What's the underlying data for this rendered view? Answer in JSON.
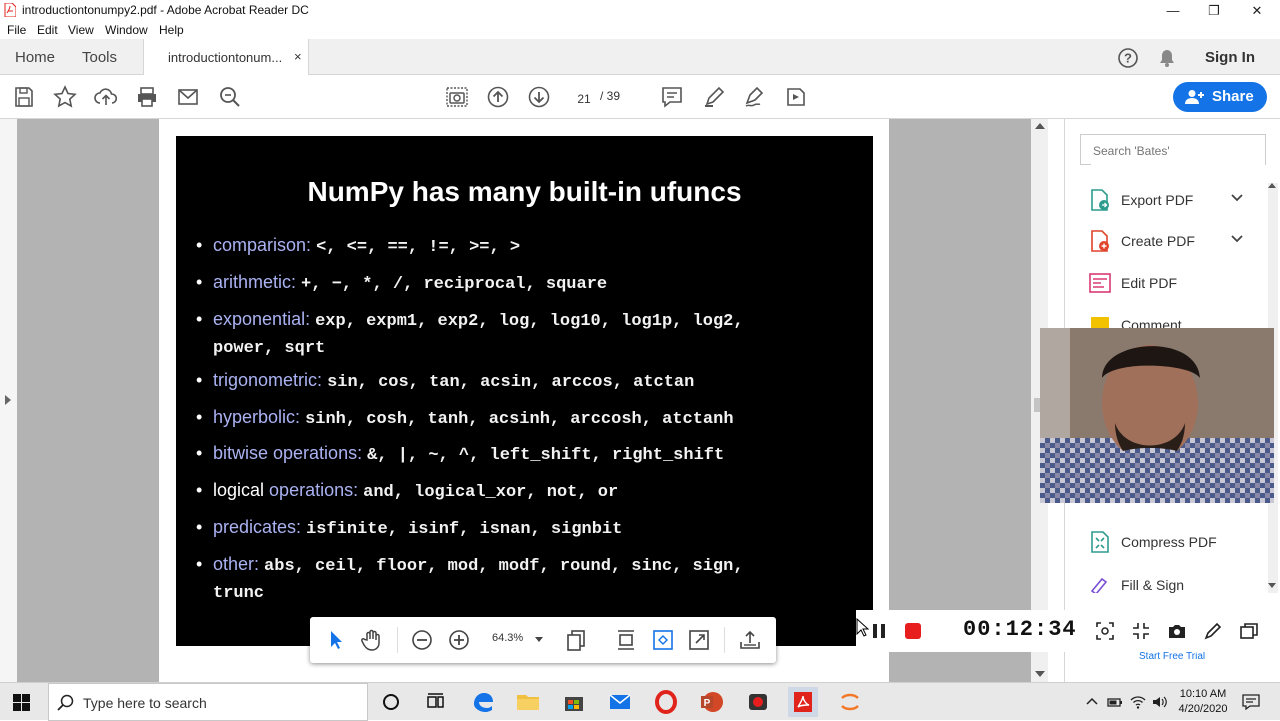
{
  "window": {
    "title": "introductiontonumpy2.pdf - Adobe Acrobat Reader DC",
    "controls": [
      "—",
      "❐",
      "✕"
    ]
  },
  "menu": [
    "File",
    "Edit",
    "View",
    "Window",
    "Help"
  ],
  "tabs": {
    "home": "Home",
    "tools": "Tools",
    "doc": "introductiontonum...",
    "close": "×"
  },
  "header_right": {
    "help": "?",
    "signin": "Sign In"
  },
  "toolbar": {
    "page_current": "21",
    "page_sep": "/ 39",
    "share_label": "Share"
  },
  "slide": {
    "title": "NumPy has many built-in ufuncs",
    "bullets": [
      {
        "label": "comparison:",
        "items": "<, <=, ==, !=, >=, >"
      },
      {
        "label": "arithmetic:",
        "items": "+, −, *, /, reciprocal, square"
      },
      {
        "label": "exponential:",
        "items": "exp, expm1, exp2, log, log10, log1p, log2,",
        "items2": "power, sqrt"
      },
      {
        "label": "trigonometric:",
        "items": "sin, cos, tan, acsin, arccos, atctan"
      },
      {
        "label": "hyperbolic:",
        "items": "sinh, cosh, tanh, acsinh, arccosh, atctanh"
      },
      {
        "label": "bitwise operations:",
        "items": "&, |, ~, ^, left_shift, right_shift"
      },
      {
        "label_white": "logical",
        "label": "operations:",
        "items": "and, logical_xor, not, or"
      },
      {
        "label": "predicates:",
        "items": "isfinite, isinf, isnan, signbit"
      },
      {
        "label": "other:",
        "items": "abs, ceil, floor, mod, modf, round, sinc, sign,",
        "items2": "trunc"
      }
    ]
  },
  "rightpane": {
    "search_placeholder": "Search 'Bates'",
    "tools": [
      {
        "name": "Export PDF",
        "color": "#2d9c8f"
      },
      {
        "name": "Create PDF",
        "color": "#e0442b"
      },
      {
        "name": "Edit PDF",
        "color": "#d83b74"
      },
      {
        "name": "Comment",
        "color": "#f2c200"
      },
      {
        "name": "Compress PDF",
        "color": "#2d9c8f"
      },
      {
        "name": "Fill & Sign",
        "color": "#7a4fd6"
      }
    ],
    "start_trial": "Start Free Trial"
  },
  "floatbar": {
    "zoom": "64.3%"
  },
  "recorder": {
    "timer": "00:12:34",
    "record_color": "#e81e1e"
  },
  "taskbar": {
    "search_placeholder": "Type here to search",
    "time": "10:10 AM",
    "date": "4/20/2020"
  },
  "colors": {
    "accent": "#1473e6",
    "slide_keyword": "#aab2f2",
    "acrobat_red": "#e0231b"
  }
}
